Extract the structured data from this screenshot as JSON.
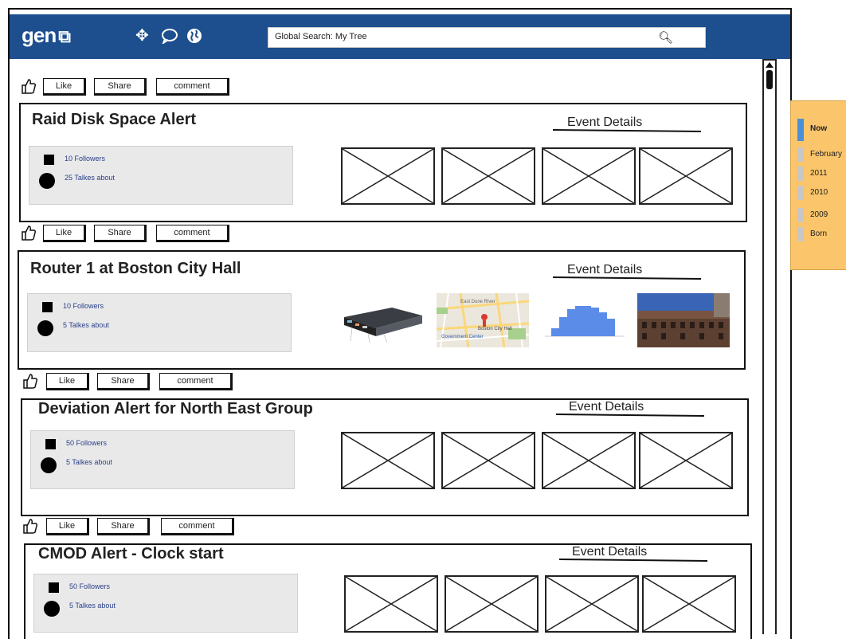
{
  "app": {
    "logo": "gen"
  },
  "header": {
    "icons": [
      "move-icon",
      "chat-icon",
      "globe-icon"
    ],
    "search_value": "Global Search: My Tree"
  },
  "actions": {
    "like": "Like",
    "share": "Share",
    "comment": "comment"
  },
  "event_details_label": "Event Details",
  "posts": [
    {
      "title": "Raid Disk Space Alert",
      "followers": "10 Followers",
      "talks": "25 Talkes about"
    },
    {
      "title": "Router 1 at Boston City Hall",
      "followers": "10 Followers",
      "talks": "5 Talkes about"
    },
    {
      "title": "Deviation Alert for North East Group",
      "followers": "50 Followers",
      "talks": "5 Talkes about"
    },
    {
      "title": "CMOD Alert - Clock start",
      "followers": "50 Followers",
      "talks": "5 Talkes about"
    }
  ],
  "map_thumb": {
    "labels": [
      "East Dune River",
      "Boston City Hall",
      "Government Center"
    ]
  },
  "timeline": {
    "items": [
      "Now",
      "February",
      "2011",
      "2010",
      "2009",
      "Born"
    ],
    "active": "Now"
  },
  "colors": {
    "header": "#1d4f8e",
    "timeline": "#fbc56c",
    "accent": "#4a90d9",
    "stats_bg": "#e9e9e9"
  }
}
